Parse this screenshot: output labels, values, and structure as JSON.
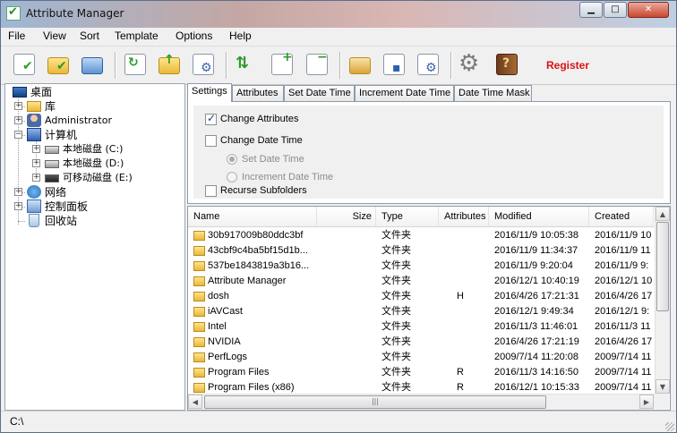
{
  "window": {
    "title": "Attribute Manager",
    "buttons": {
      "minimize": "▁",
      "maximize": "□",
      "close": "✕"
    }
  },
  "menu": [
    "File",
    "View",
    "Sort",
    "Template",
    "Options",
    "Help"
  ],
  "toolbar": {
    "register_label": "Register",
    "buttons": [
      "add-files",
      "add-folder",
      "refresh",
      "swap",
      "go-up",
      "settings-doc",
      "move-up-down",
      "add-list",
      "remove-list",
      "clipboard",
      "save-clipboard",
      "template-settings",
      "options-gear",
      "help-book"
    ],
    "accent_color": "#d81414"
  },
  "tree": {
    "items": [
      {
        "label": "桌面",
        "icon": "desktop-icon"
      },
      {
        "label": "库",
        "icon": "library-icon"
      },
      {
        "label": "Administrator",
        "icon": "user-icon"
      },
      {
        "label": "计算机",
        "icon": "computer-icon"
      },
      {
        "label": "本地磁盘 (C:)",
        "icon": "drive-icon"
      },
      {
        "label": "本地磁盘 (D:)",
        "icon": "drive-icon"
      },
      {
        "label": "可移动磁盘 (E:)",
        "icon": "removable-drive-icon"
      },
      {
        "label": "网络",
        "icon": "network-icon"
      },
      {
        "label": "控制面板",
        "icon": "control-panel-icon"
      },
      {
        "label": "回收站",
        "icon": "recycle-bin-icon"
      }
    ]
  },
  "tabs": [
    "Settings",
    "Attributes",
    "Set Date Time",
    "Increment Date Time",
    "Date Time Mask"
  ],
  "active_tab": "Settings",
  "settings": {
    "change_attributes": {
      "label": "Change Attributes",
      "checked": true
    },
    "change_date_time": {
      "label": "Change Date Time",
      "checked": false
    },
    "set_date_time": {
      "label": "Set Date Time",
      "selected": true
    },
    "increment_date_time": {
      "label": "Increment Date Time",
      "selected": false
    },
    "recurse_subfolders": {
      "label": "Recurse Subfolders",
      "checked": false
    }
  },
  "filelist": {
    "columns": [
      "Name",
      "Size",
      "Type",
      "Attributes",
      "Modified",
      "Created"
    ],
    "rows": [
      {
        "name": "30b917009b80ddc3bf",
        "size": "",
        "type": "文件夹",
        "attributes": "",
        "modified": "2016/11/9 10:05:38",
        "created": "2016/11/9 10"
      },
      {
        "name": "43cbf9c4ba5bf15d1b...",
        "size": "",
        "type": "文件夹",
        "attributes": "",
        "modified": "2016/11/9 11:34:37",
        "created": "2016/11/9 11"
      },
      {
        "name": "537be1843819a3b16...",
        "size": "",
        "type": "文件夹",
        "attributes": "",
        "modified": "2016/11/9 9:20:04",
        "created": "2016/11/9 9:"
      },
      {
        "name": "Attribute Manager",
        "size": "",
        "type": "文件夹",
        "attributes": "",
        "modified": "2016/12/1 10:40:19",
        "created": "2016/12/1 10"
      },
      {
        "name": "dosh",
        "size": "",
        "type": "文件夹",
        "attributes": "H",
        "modified": "2016/4/26 17:21:31",
        "created": "2016/4/26 17"
      },
      {
        "name": "iAVCast",
        "size": "",
        "type": "文件夹",
        "attributes": "",
        "modified": "2016/12/1 9:49:34",
        "created": "2016/12/1 9:"
      },
      {
        "name": "Intel",
        "size": "",
        "type": "文件夹",
        "attributes": "",
        "modified": "2016/11/3 11:46:01",
        "created": "2016/11/3 11"
      },
      {
        "name": "NVIDIA",
        "size": "",
        "type": "文件夹",
        "attributes": "",
        "modified": "2016/4/26 17:21:19",
        "created": "2016/4/26 17"
      },
      {
        "name": "PerfLogs",
        "size": "",
        "type": "文件夹",
        "attributes": "",
        "modified": "2009/7/14 11:20:08",
        "created": "2009/7/14 11"
      },
      {
        "name": "Program Files",
        "size": "",
        "type": "文件夹",
        "attributes": "R",
        "modified": "2016/11/3 14:16:50",
        "created": "2009/7/14 11"
      },
      {
        "name": "Program Files (x86)",
        "size": "",
        "type": "文件夹",
        "attributes": "R",
        "modified": "2016/12/1 10:15:33",
        "created": "2009/7/14 11"
      }
    ]
  },
  "status": {
    "path": "C:\\"
  }
}
